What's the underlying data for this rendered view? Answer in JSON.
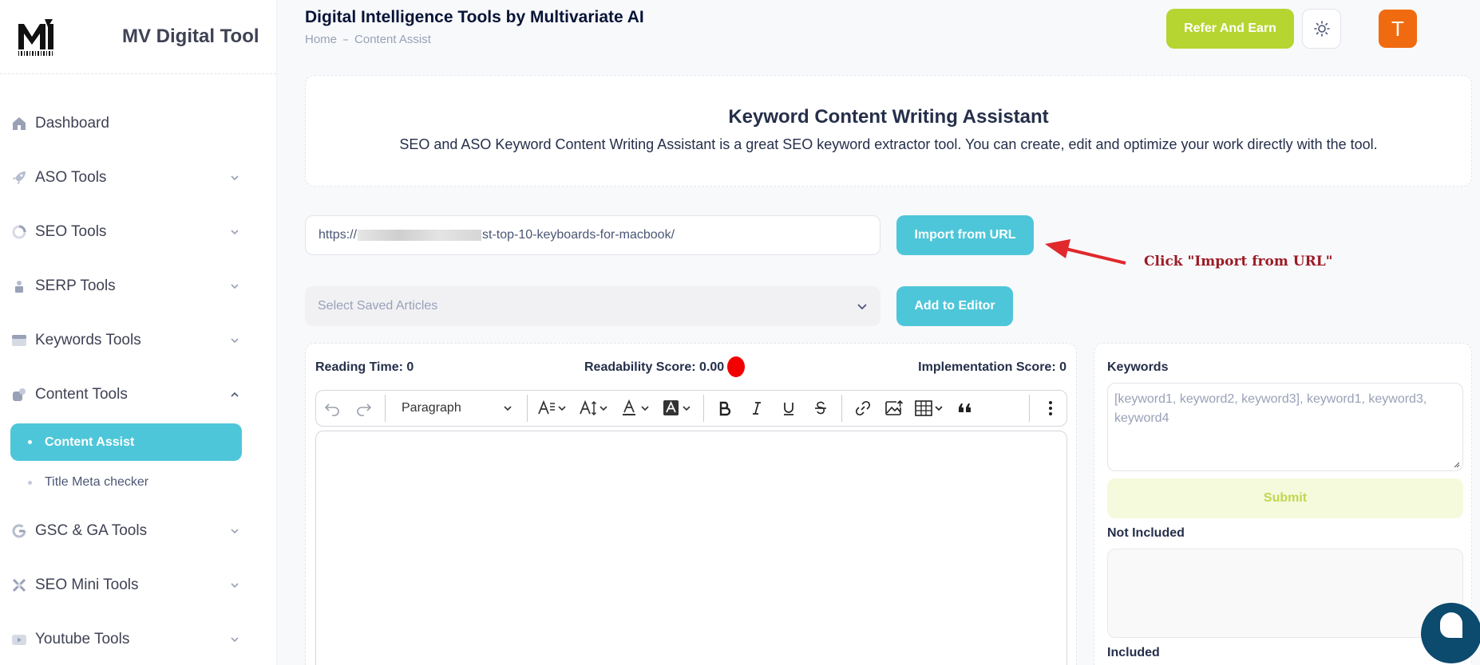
{
  "sidebar": {
    "brand_name": "MV Digital Tool",
    "items": [
      {
        "label": "Dashboard",
        "icon": "home-icon",
        "expandable": false
      },
      {
        "label": "ASO Tools",
        "icon": "rocket-icon",
        "expandable": true
      },
      {
        "label": "SEO Tools",
        "icon": "chart-ring-icon",
        "expandable": true
      },
      {
        "label": "SERP Tools",
        "icon": "bar-chart-icon",
        "expandable": true
      },
      {
        "label": "Keywords Tools",
        "icon": "browser-window-icon",
        "expandable": true
      },
      {
        "label": "Content Tools",
        "icon": "content-icon",
        "expandable": true,
        "expanded": true
      },
      {
        "label": "GSC & GA Tools",
        "icon": "google-icon",
        "expandable": true
      },
      {
        "label": "SEO Mini Tools",
        "icon": "tools-icon",
        "expandable": true
      },
      {
        "label": "Youtube Tools",
        "icon": "youtube-icon",
        "expandable": true
      }
    ],
    "sub_items": [
      {
        "label": "Content Assist",
        "active": true
      },
      {
        "label": "Title Meta checker",
        "active": false
      }
    ]
  },
  "header": {
    "title": "Digital Intelligence Tools by Multivariate AI",
    "breadcrumb": [
      "Home",
      "Content Assist"
    ],
    "refer_label": "Refer And Earn",
    "avatar_letter": "T"
  },
  "intro": {
    "title": "Keyword Content Writing Assistant",
    "description": "SEO and ASO Keyword Content Writing Assistant is a great SEO keyword extractor tool. You can create, edit and optimize your work directly with the tool."
  },
  "url_import": {
    "url_prefix": "https://",
    "url_suffix": "st-top-10-keyboards-for-macbook/",
    "button_label": "Import from URL",
    "annotation": "Click \"Import from URL\""
  },
  "saved_articles": {
    "placeholder": "Select Saved Articles",
    "add_label": "Add to Editor"
  },
  "editor": {
    "reading_time": "Reading Time: 0",
    "readability_score": "Readability Score: 0.00",
    "implementation_score": "Implementation Score: 0",
    "paragraph_label": "Paragraph"
  },
  "keywords_panel": {
    "keywords_label": "Keywords",
    "placeholder": "[keyword1, keyword2, keyword3], keyword1, keyword3, keyword4",
    "submit_label": "Submit",
    "not_included_label": "Not Included",
    "included_label": "Included"
  },
  "colors": {
    "accent_cyan": "#4ec6d9",
    "refer_green": "#b6d531",
    "avatar_orange": "#f06b10",
    "readability_red": "#f20000",
    "annotation_red": "#9b1b25",
    "chat_navy": "#0c4a6e"
  }
}
